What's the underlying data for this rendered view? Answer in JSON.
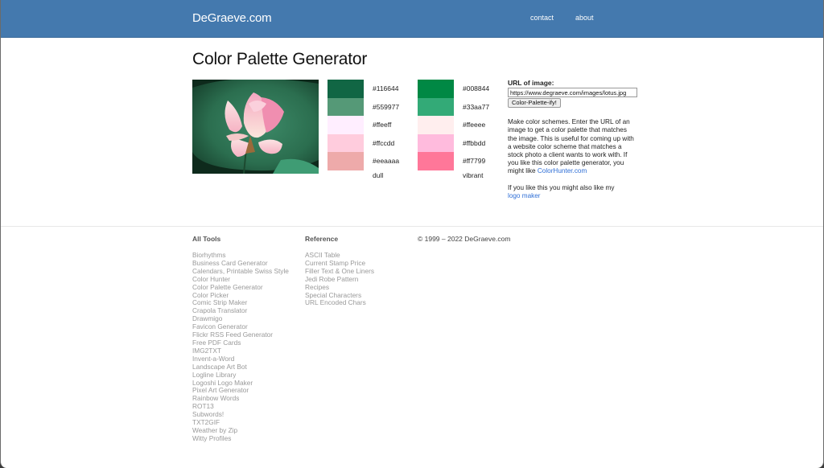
{
  "header": {
    "brand": "DeGraeve.com",
    "nav": [
      {
        "label": "contact"
      },
      {
        "label": "about"
      }
    ],
    "bg_color": "#4479ae"
  },
  "page_title": "Color Palette Generator",
  "image": {
    "description": "pink lotus flower on green leaf"
  },
  "palettes": {
    "dull": {
      "label": "dull",
      "colors": [
        "#116644",
        "#559977",
        "#ffeeff",
        "#ffccdd",
        "#eeaaaa"
      ]
    },
    "vibrant": {
      "label": "vibrant",
      "colors": [
        "#008844",
        "#33aa77",
        "#ffeeee",
        "#ffbbdd",
        "#ff7799"
      ]
    }
  },
  "form": {
    "label": "URL of image:",
    "url_value": "https://www.degraeve.com/images/lotus.jpg",
    "button_label": "Color-Palette-ify!"
  },
  "description": {
    "text": "Make color schemes. Enter the URL of an image to get a color palette that matches the image. This is useful for coming up with a website color scheme that matches a stock photo a client wants to work with. If you like this color palette generator, you might like ",
    "link": "ColorHunter.com",
    "text2": "If you like this you might also like my ",
    "link2": "logo maker"
  },
  "footer": {
    "tools_heading": "All Tools",
    "tools": [
      "Biorhythms",
      "Business Card Generator",
      "Calendars, Printable Swiss Style",
      "Color Hunter",
      "Color Palette Generator",
      "Color Picker",
      "Comic Strip Maker",
      "Crapola Translator",
      "Drawmigo",
      "Favicon Generator",
      "Flickr RSS Feed Generator",
      "Free PDF Cards",
      "IMG2TXT",
      "Invent-a-Word",
      "Landscape Art Bot",
      "Logline Library",
      "Logoshi Logo Maker",
      "Pixel Art Generator",
      "Rainbow Words",
      "ROT13",
      "Subwords!",
      "TXT2GIF",
      "Weather by Zip",
      "Witty Profiles"
    ],
    "reference_heading": "Reference",
    "reference": [
      "ASCII Table",
      "Current Stamp Price",
      "Filler Text & One Liners",
      "Jedi Robe Pattern",
      "Recipes",
      "Special Characters",
      "URL Encoded Chars"
    ],
    "copyright": "© 1999 – 2022 DeGraeve.com"
  }
}
